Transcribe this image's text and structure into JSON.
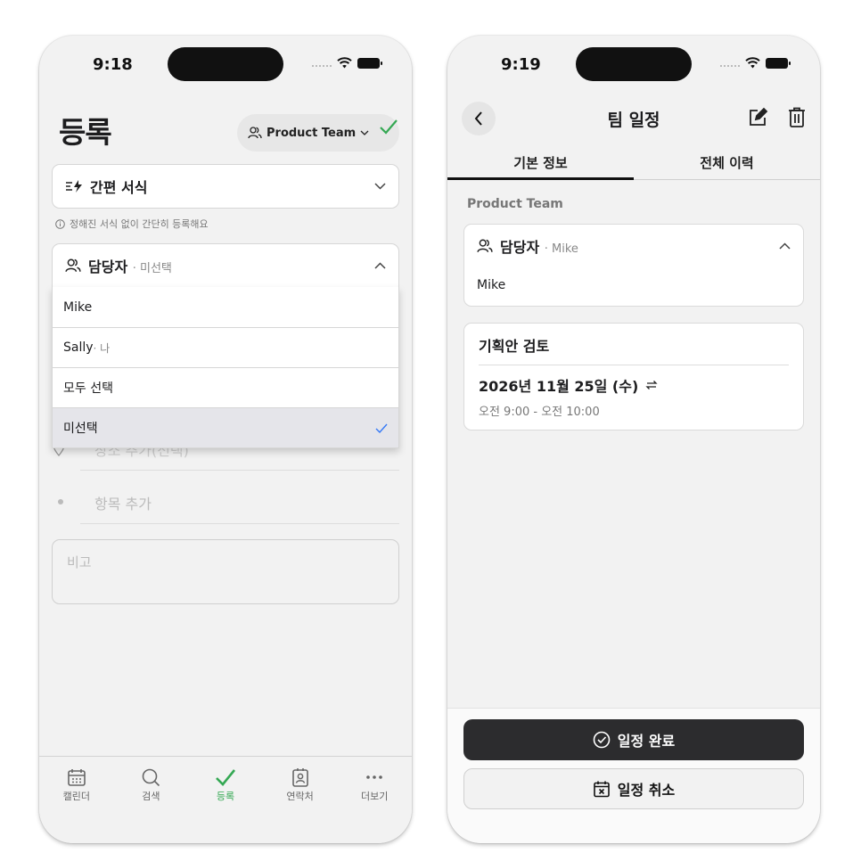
{
  "left": {
    "status_time": "9:18",
    "page_title": "등록",
    "team_chip": "Product Team",
    "quick_format": "간편 서식",
    "hint": "정해진 서식 없이 간단히 등록해요",
    "assignee_label": "담당자",
    "assignee_sub": "· 미선택",
    "dropdown": [
      {
        "label": "Mike",
        "sub": ""
      },
      {
        "label": "Sally",
        "sub": " · 나"
      },
      {
        "label": "모두 선택",
        "sub": ""
      },
      {
        "label": "미선택",
        "sub": ""
      }
    ],
    "location_placeholder": "장소 추가(선택)",
    "add_item_placeholder": "항목 추가",
    "note_placeholder": "비고",
    "tabs": [
      "캘린더",
      "검색",
      "등록",
      "연락처",
      "더보기"
    ],
    "accent_color": "#34a853"
  },
  "right": {
    "status_time": "9:19",
    "nav_title": "팀 일정",
    "seg_tabs": [
      "기본 정보",
      "전체 이력"
    ],
    "team_label": "Product Team",
    "assignee_label": "담당자",
    "assignee_sub": "· Mike",
    "assignee_value": "Mike",
    "event_title": "기획안 검토",
    "event_date": "2026년 11월 25일 (수)",
    "event_time": "오전 9:00 - 오전 10:00",
    "complete_button": "일정 완료",
    "cancel_button": "일정 취소"
  }
}
